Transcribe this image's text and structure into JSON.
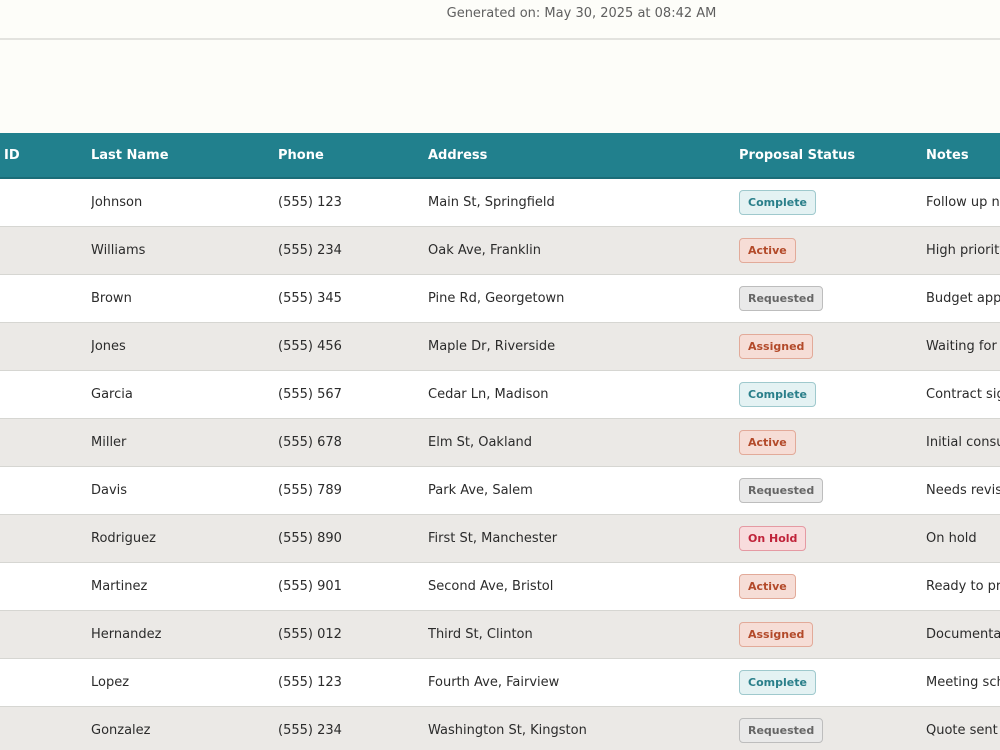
{
  "report": {
    "generated_text": "Generated on: May 30, 2025 at 08:42 AM"
  },
  "table": {
    "headers": {
      "id": "ID",
      "last_name": "Last Name",
      "phone": "Phone",
      "address": "Address",
      "status": "Proposal Status",
      "notes": "Notes"
    },
    "rows": [
      {
        "last_name": "Johnson",
        "phone": "(555) 123",
        "address": "Main St, Springfield",
        "status": "Complete",
        "notes": "Follow up nee"
      },
      {
        "last_name": "Williams",
        "phone": "(555) 234",
        "address": "Oak Ave, Franklin",
        "status": "Active",
        "notes": "High priority c"
      },
      {
        "last_name": "Brown",
        "phone": "(555) 345",
        "address": "Pine Rd, Georgetown",
        "status": "Requested",
        "notes": "Budget appro"
      },
      {
        "last_name": "Jones",
        "phone": "(555) 456",
        "address": "Maple Dr, Riverside",
        "status": "Assigned",
        "notes": "Waiting for ap"
      },
      {
        "last_name": "Garcia",
        "phone": "(555) 567",
        "address": "Cedar Ln, Madison",
        "status": "Complete",
        "notes": "Contract signe"
      },
      {
        "last_name": "Miller",
        "phone": "(555) 678",
        "address": "Elm St, Oakland",
        "status": "Active",
        "notes": "Initial consulta"
      },
      {
        "last_name": "Davis",
        "phone": "(555) 789",
        "address": "Park Ave, Salem",
        "status": "Requested",
        "notes": "Needs revision"
      },
      {
        "last_name": "Rodriguez",
        "phone": "(555) 890",
        "address": "First St, Manchester",
        "status": "On Hold",
        "notes": "On hold"
      },
      {
        "last_name": "Martinez",
        "phone": "(555) 901",
        "address": "Second Ave, Bristol",
        "status": "Active",
        "notes": "Ready to proc"
      },
      {
        "last_name": "Hernandez",
        "phone": "(555) 012",
        "address": "Third St, Clinton",
        "status": "Assigned",
        "notes": "Documentatio"
      },
      {
        "last_name": "Lopez",
        "phone": "(555) 123",
        "address": "Fourth Ave, Fairview",
        "status": "Complete",
        "notes": "Meeting sched"
      },
      {
        "last_name": "Gonzalez",
        "phone": "(555) 234",
        "address": "Washington St, Kingston",
        "status": "Requested",
        "notes": "Quote sent"
      }
    ]
  },
  "colors": {
    "header_bg": "#21808d",
    "row_alt_bg": "#ebe9e6",
    "page_bg": "#fdfdf9"
  }
}
